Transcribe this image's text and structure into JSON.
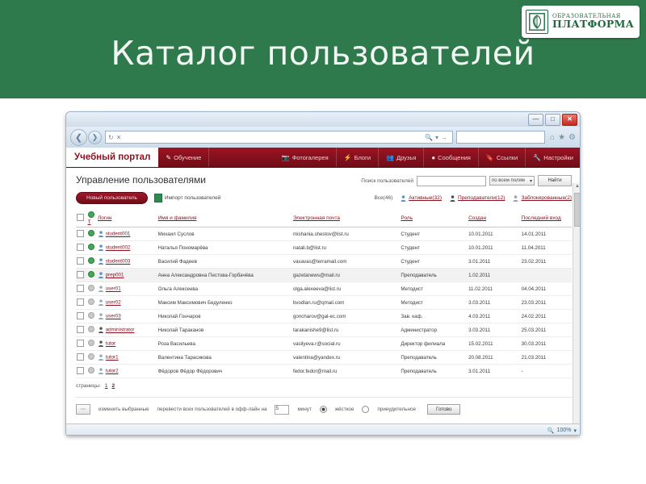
{
  "slide": {
    "title": "Каталог пользователей",
    "logo": {
      "line1": "ОБРАЗОВАТЕЛЬНАЯ",
      "line2": "ПЛАТФОРМА",
      "icon": "book-leaf-logo-icon"
    }
  },
  "browser": {
    "window_buttons": {
      "minimize": "—",
      "maximize": "□",
      "close": "✕"
    },
    "url_value": "",
    "url_placeholder": "",
    "search_value": "",
    "back_icon": "back-arrow-icon",
    "forward_icon": "forward-arrow-icon",
    "refresh_icon": "refresh-icon",
    "stop_icon": "stop-icon",
    "go_icon": "go-arrow-icon",
    "home_icon": "home-icon",
    "favorites_icon": "star-icon",
    "tools_icon": "gear-icon",
    "zoom_level": "100%"
  },
  "site_nav": {
    "brand": "Учебный портал",
    "items": [
      {
        "label": "Обучение",
        "icon": "pencil-icon"
      },
      {
        "label": "Фотогалерея",
        "icon": "camera-icon"
      },
      {
        "label": "Блоги",
        "icon": "lightning-icon"
      },
      {
        "label": "Друзья",
        "icon": "people-icon"
      },
      {
        "label": "Сообщения",
        "icon": "speech-bubble-icon"
      },
      {
        "label": "Ссылки",
        "icon": "bookmark-icon"
      },
      {
        "label": "Настройки",
        "icon": "wrench-icon"
      }
    ]
  },
  "page": {
    "title": "Управление пользователями",
    "search": {
      "label": "Поиск пользователей",
      "value": "",
      "field_select": "по всем полям",
      "find_button": "Найти"
    },
    "actions": {
      "new_user": "Новый пользователь",
      "import": "Импорт пользователей"
    },
    "filters": [
      {
        "label": "Все(46)",
        "icon": "all-users-icon",
        "link": false
      },
      {
        "label": "Активные(32)",
        "icon": "active-user-icon",
        "link": true
      },
      {
        "label": "Преподаватели(12)",
        "icon": "teacher-icon",
        "link": true
      },
      {
        "label": "Заблокированные(2)",
        "icon": "blocked-user-icon",
        "link": true
      }
    ],
    "table": {
      "headers": {
        "select_all": "select-all-checkbox",
        "status": "Т",
        "login": "Логин",
        "name": "Имя и фамилия",
        "email": "Электронная почта",
        "role": "Роль",
        "created": "Создан",
        "last_login": "Последний вход"
      },
      "rows": [
        {
          "active": true,
          "login": "student001",
          "name": "Михаил Суслов",
          "email": "mishania.shestov@list.ru",
          "role": "Студент",
          "created": "10.01.2011",
          "last": "14.01.2011",
          "selected": false
        },
        {
          "active": true,
          "login": "student002",
          "name": "Наталья Пономарёва",
          "email": "natali.b@list.ru",
          "role": "Студент",
          "created": "10.01.2011",
          "last": "11.04.2011",
          "selected": false
        },
        {
          "active": true,
          "login": "student003",
          "name": "Василий Фадеев",
          "email": "vasavas@terramail.com",
          "role": "Студент",
          "created": "3.01.2011",
          "last": "23.02.2011",
          "selected": false
        },
        {
          "active": true,
          "login": "prep001",
          "name": "Анна Александровна Пестова-Горбачёва",
          "email": "gazetanews@mail.ru",
          "role": "Преподаватель",
          "created": "1.02.2011",
          "last": "",
          "selected": true
        },
        {
          "active": false,
          "login": "user01",
          "name": "Ольга Алексеева",
          "email": "olga.alexeeva@list.ru",
          "role": "Методист",
          "created": "11.02.2011",
          "last": "04.04.2011",
          "selected": false
        },
        {
          "active": false,
          "login": "user02",
          "name": "Максим Максимович Бедуленко",
          "email": "bvodlan.ru@qmail.com",
          "role": "Методист",
          "created": "3.03.2011",
          "last": "23.03.2011",
          "selected": false
        },
        {
          "active": false,
          "login": "user03",
          "name": "Николай Гончаров",
          "email": "goncharov@gal-ec.com",
          "role": "Зав. каф.",
          "created": "4.03.2011",
          "last": "24.02.2011",
          "selected": false
        },
        {
          "active": false,
          "login": "administrator",
          "login_link": true,
          "name": "Николай Тараканов",
          "email": "tarakanishe9@list.ru",
          "role": "Администратор",
          "created": "3.03.2011",
          "last": "25.03.2011",
          "selected": false
        },
        {
          "active": false,
          "login": "tutor",
          "name": "Роза Васильева",
          "email": "vasilyeva.r@social.ru",
          "role": "Директор филиала",
          "created": "15.02.2011",
          "last": "30.03.2011",
          "selected": false
        },
        {
          "active": false,
          "login": "tutor1",
          "name": "Валентина Тарасикова",
          "email": "valentina@yandex.ru",
          "role": "Преподаватель",
          "created": "20.08.2011",
          "last": "21.03.2011",
          "selected": false
        },
        {
          "active": false,
          "login": "tutor2",
          "name": "Фёдоров Фёдор Фёдорович",
          "email": "fedor.fedor@mail.ru",
          "role": "Преподаватель",
          "created": "3.01.2011",
          "last": "-",
          "selected": false
        }
      ]
    },
    "paging": {
      "label": "страницы:",
      "pages": [
        "1",
        "2"
      ],
      "current": "2"
    },
    "bottom": {
      "edit_selected": "изменить выбранные",
      "logout_label": "перевести всех пользователей в офф-лайн на",
      "minutes_value": "5",
      "minutes_label": "минут",
      "option_hard": "жёсткое",
      "option_soft": "принудительное",
      "done_button": "Готово"
    }
  }
}
